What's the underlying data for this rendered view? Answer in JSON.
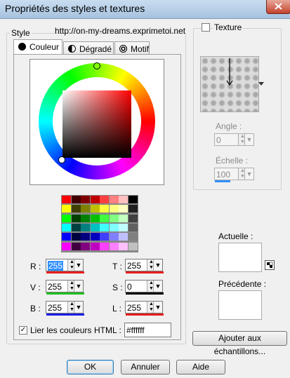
{
  "window": {
    "title": "Propriétés des styles et textures"
  },
  "style_group": {
    "legend": "Style",
    "url_text": "http://on-my-dreams.exprimetoi.net"
  },
  "tabs": [
    {
      "label": "Couleur",
      "icon": "filled-circle-icon"
    },
    {
      "label": "Dégradé",
      "icon": "gradient-half-icon"
    },
    {
      "label": "Motif",
      "icon": "pattern-icon"
    }
  ],
  "fields": {
    "r": {
      "label": "R :",
      "value": "255",
      "bar_color": "#e81e1e"
    },
    "v": {
      "label": "V :",
      "value": "255",
      "bar_color": "#20c020"
    },
    "b": {
      "label": "B :",
      "value": "255",
      "bar_color": "#1e1ee8"
    },
    "t": {
      "label": "T :",
      "value": "255",
      "bar_color": "#e81e1e"
    },
    "s": {
      "label": "S :",
      "value": "0",
      "bar_color": "#000000"
    },
    "l": {
      "label": "L :",
      "value": "255",
      "bar_color": "#e81e1e"
    }
  },
  "link_colors": {
    "label": "Lier les couleurs",
    "checked": true
  },
  "html_field": {
    "label": "HTML :",
    "value": "#ffffff"
  },
  "texture": {
    "label": "Texture",
    "checked": false
  },
  "angle": {
    "label": "Angle :",
    "value": "0"
  },
  "scale": {
    "label": "Échelle :",
    "value": "100"
  },
  "current": {
    "label": "Actuelle :"
  },
  "previous": {
    "label": "Précédente :"
  },
  "buttons": {
    "add_swatches": "Ajouter aux échantillons...",
    "ok": "OK",
    "cancel": "Annuler",
    "help": "Aide"
  },
  "palette": [
    [
      "#ff0000",
      "#400000",
      "#800000",
      "#c00000",
      "#ff4040",
      "#ff8080",
      "#ffc0c0",
      "#000000"
    ],
    [
      "#ffff00",
      "#404000",
      "#808000",
      "#c0c000",
      "#ffff40",
      "#ffff80",
      "#ffffc0",
      "#202020"
    ],
    [
      "#00ff00",
      "#004000",
      "#008000",
      "#00c000",
      "#40ff40",
      "#80ff80",
      "#c0ffc0",
      "#404040"
    ],
    [
      "#00ffff",
      "#004040",
      "#008080",
      "#00c0c0",
      "#40ffff",
      "#80ffff",
      "#c0ffff",
      "#606060"
    ],
    [
      "#0000ff",
      "#000040",
      "#000080",
      "#0000c0",
      "#4040ff",
      "#8080ff",
      "#c0c0ff",
      "#808080"
    ],
    [
      "#ff00ff",
      "#400040",
      "#800080",
      "#c000c0",
      "#ff40ff",
      "#ff80ff",
      "#ffc0ff",
      "#c0c0c0"
    ]
  ]
}
